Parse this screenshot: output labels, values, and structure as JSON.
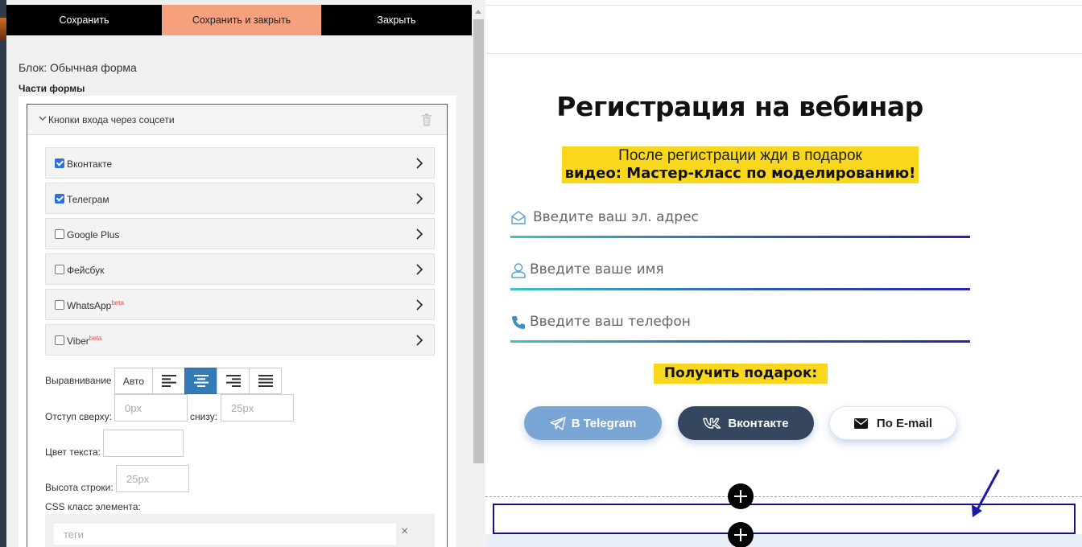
{
  "toolbar": {
    "save_label": "Сохранить",
    "save_close_label": "Сохранить и закрыть",
    "close_label": "Закрыть"
  },
  "editor": {
    "block_title": "Блок: Обычная форма",
    "parts_title": "Части формы",
    "section": {
      "title": "Кнопки входа через соцсети",
      "items": [
        {
          "label": "Вконтакте",
          "checked": true,
          "beta": ""
        },
        {
          "label": "Телеграм",
          "checked": true,
          "beta": ""
        },
        {
          "label": "Google Plus",
          "checked": false,
          "beta": ""
        },
        {
          "label": "Фейсбук",
          "checked": false,
          "beta": ""
        },
        {
          "label": "WhatsApp",
          "checked": false,
          "beta": "beta"
        },
        {
          "label": "Viber",
          "checked": false,
          "beta": "beta"
        }
      ]
    },
    "alignment": {
      "label": "Выравнивание",
      "auto_label": "Авто",
      "selected": "center"
    },
    "padding": {
      "top_label": "Отступ сверху:",
      "top_placeholder": "0px",
      "bottom_label": "снизу:",
      "bottom_placeholder": "25px"
    },
    "text_color": {
      "label": "Цвет текста:",
      "value": ""
    },
    "line_height": {
      "label": "Высота строки:",
      "placeholder": "25px"
    },
    "css_class": {
      "label": "CSS класс элемента:",
      "placeholder": "теги",
      "clear_icon": "×"
    }
  },
  "preview": {
    "title": "Регистрация на вебинар",
    "promo_line1": "После регистрации жди в подарок",
    "promo_line2": "видео: Мастер-класс по моделированию!",
    "fields": [
      {
        "placeholder": "Введите ваш эл. адрес",
        "icon": "envelope-icon"
      },
      {
        "placeholder": "Введите ваше имя",
        "icon": "user-icon"
      },
      {
        "placeholder": "Введите ваш телефон",
        "icon": "phone-icon"
      }
    ],
    "gift_label": "Получить подарок:",
    "buttons": {
      "telegram": "В Telegram",
      "vk": "Вконтакте",
      "email": "По E-mail"
    }
  },
  "colors": {
    "save_close_bg": "#f6a07e",
    "active_align": "#337ab7",
    "highlight": "#f9d71c",
    "telegram_btn": "#7aa6d6",
    "vk_btn": "#35475e",
    "selection_border": "#1b0f8f"
  }
}
